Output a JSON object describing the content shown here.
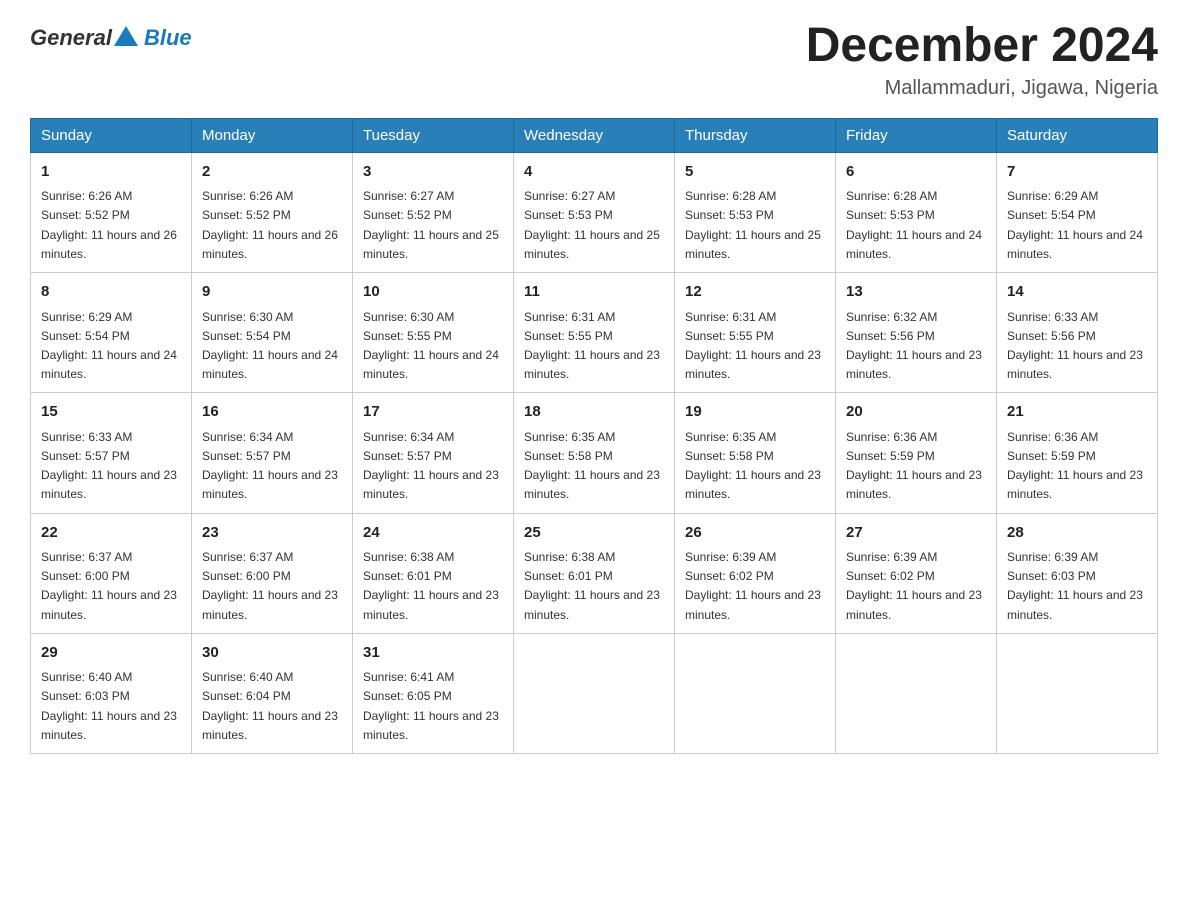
{
  "header": {
    "logo_general": "General",
    "logo_blue": "Blue",
    "month_title": "December 2024",
    "location": "Mallammaduri, Jigawa, Nigeria"
  },
  "days_of_week": [
    "Sunday",
    "Monday",
    "Tuesday",
    "Wednesday",
    "Thursday",
    "Friday",
    "Saturday"
  ],
  "weeks": [
    [
      {
        "day": "1",
        "sunrise": "6:26 AM",
        "sunset": "5:52 PM",
        "daylight": "11 hours and 26 minutes."
      },
      {
        "day": "2",
        "sunrise": "6:26 AM",
        "sunset": "5:52 PM",
        "daylight": "11 hours and 26 minutes."
      },
      {
        "day": "3",
        "sunrise": "6:27 AM",
        "sunset": "5:52 PM",
        "daylight": "11 hours and 25 minutes."
      },
      {
        "day": "4",
        "sunrise": "6:27 AM",
        "sunset": "5:53 PM",
        "daylight": "11 hours and 25 minutes."
      },
      {
        "day": "5",
        "sunrise": "6:28 AM",
        "sunset": "5:53 PM",
        "daylight": "11 hours and 25 minutes."
      },
      {
        "day": "6",
        "sunrise": "6:28 AM",
        "sunset": "5:53 PM",
        "daylight": "11 hours and 24 minutes."
      },
      {
        "day": "7",
        "sunrise": "6:29 AM",
        "sunset": "5:54 PM",
        "daylight": "11 hours and 24 minutes."
      }
    ],
    [
      {
        "day": "8",
        "sunrise": "6:29 AM",
        "sunset": "5:54 PM",
        "daylight": "11 hours and 24 minutes."
      },
      {
        "day": "9",
        "sunrise": "6:30 AM",
        "sunset": "5:54 PM",
        "daylight": "11 hours and 24 minutes."
      },
      {
        "day": "10",
        "sunrise": "6:30 AM",
        "sunset": "5:55 PM",
        "daylight": "11 hours and 24 minutes."
      },
      {
        "day": "11",
        "sunrise": "6:31 AM",
        "sunset": "5:55 PM",
        "daylight": "11 hours and 23 minutes."
      },
      {
        "day": "12",
        "sunrise": "6:31 AM",
        "sunset": "5:55 PM",
        "daylight": "11 hours and 23 minutes."
      },
      {
        "day": "13",
        "sunrise": "6:32 AM",
        "sunset": "5:56 PM",
        "daylight": "11 hours and 23 minutes."
      },
      {
        "day": "14",
        "sunrise": "6:33 AM",
        "sunset": "5:56 PM",
        "daylight": "11 hours and 23 minutes."
      }
    ],
    [
      {
        "day": "15",
        "sunrise": "6:33 AM",
        "sunset": "5:57 PM",
        "daylight": "11 hours and 23 minutes."
      },
      {
        "day": "16",
        "sunrise": "6:34 AM",
        "sunset": "5:57 PM",
        "daylight": "11 hours and 23 minutes."
      },
      {
        "day": "17",
        "sunrise": "6:34 AM",
        "sunset": "5:57 PM",
        "daylight": "11 hours and 23 minutes."
      },
      {
        "day": "18",
        "sunrise": "6:35 AM",
        "sunset": "5:58 PM",
        "daylight": "11 hours and 23 minutes."
      },
      {
        "day": "19",
        "sunrise": "6:35 AM",
        "sunset": "5:58 PM",
        "daylight": "11 hours and 23 minutes."
      },
      {
        "day": "20",
        "sunrise": "6:36 AM",
        "sunset": "5:59 PM",
        "daylight": "11 hours and 23 minutes."
      },
      {
        "day": "21",
        "sunrise": "6:36 AM",
        "sunset": "5:59 PM",
        "daylight": "11 hours and 23 minutes."
      }
    ],
    [
      {
        "day": "22",
        "sunrise": "6:37 AM",
        "sunset": "6:00 PM",
        "daylight": "11 hours and 23 minutes."
      },
      {
        "day": "23",
        "sunrise": "6:37 AM",
        "sunset": "6:00 PM",
        "daylight": "11 hours and 23 minutes."
      },
      {
        "day": "24",
        "sunrise": "6:38 AM",
        "sunset": "6:01 PM",
        "daylight": "11 hours and 23 minutes."
      },
      {
        "day": "25",
        "sunrise": "6:38 AM",
        "sunset": "6:01 PM",
        "daylight": "11 hours and 23 minutes."
      },
      {
        "day": "26",
        "sunrise": "6:39 AM",
        "sunset": "6:02 PM",
        "daylight": "11 hours and 23 minutes."
      },
      {
        "day": "27",
        "sunrise": "6:39 AM",
        "sunset": "6:02 PM",
        "daylight": "11 hours and 23 minutes."
      },
      {
        "day": "28",
        "sunrise": "6:39 AM",
        "sunset": "6:03 PM",
        "daylight": "11 hours and 23 minutes."
      }
    ],
    [
      {
        "day": "29",
        "sunrise": "6:40 AM",
        "sunset": "6:03 PM",
        "daylight": "11 hours and 23 minutes."
      },
      {
        "day": "30",
        "sunrise": "6:40 AM",
        "sunset": "6:04 PM",
        "daylight": "11 hours and 23 minutes."
      },
      {
        "day": "31",
        "sunrise": "6:41 AM",
        "sunset": "6:05 PM",
        "daylight": "11 hours and 23 minutes."
      },
      null,
      null,
      null,
      null
    ]
  ],
  "labels": {
    "sunrise_prefix": "Sunrise: ",
    "sunset_prefix": "Sunset: ",
    "daylight_prefix": "Daylight: "
  }
}
